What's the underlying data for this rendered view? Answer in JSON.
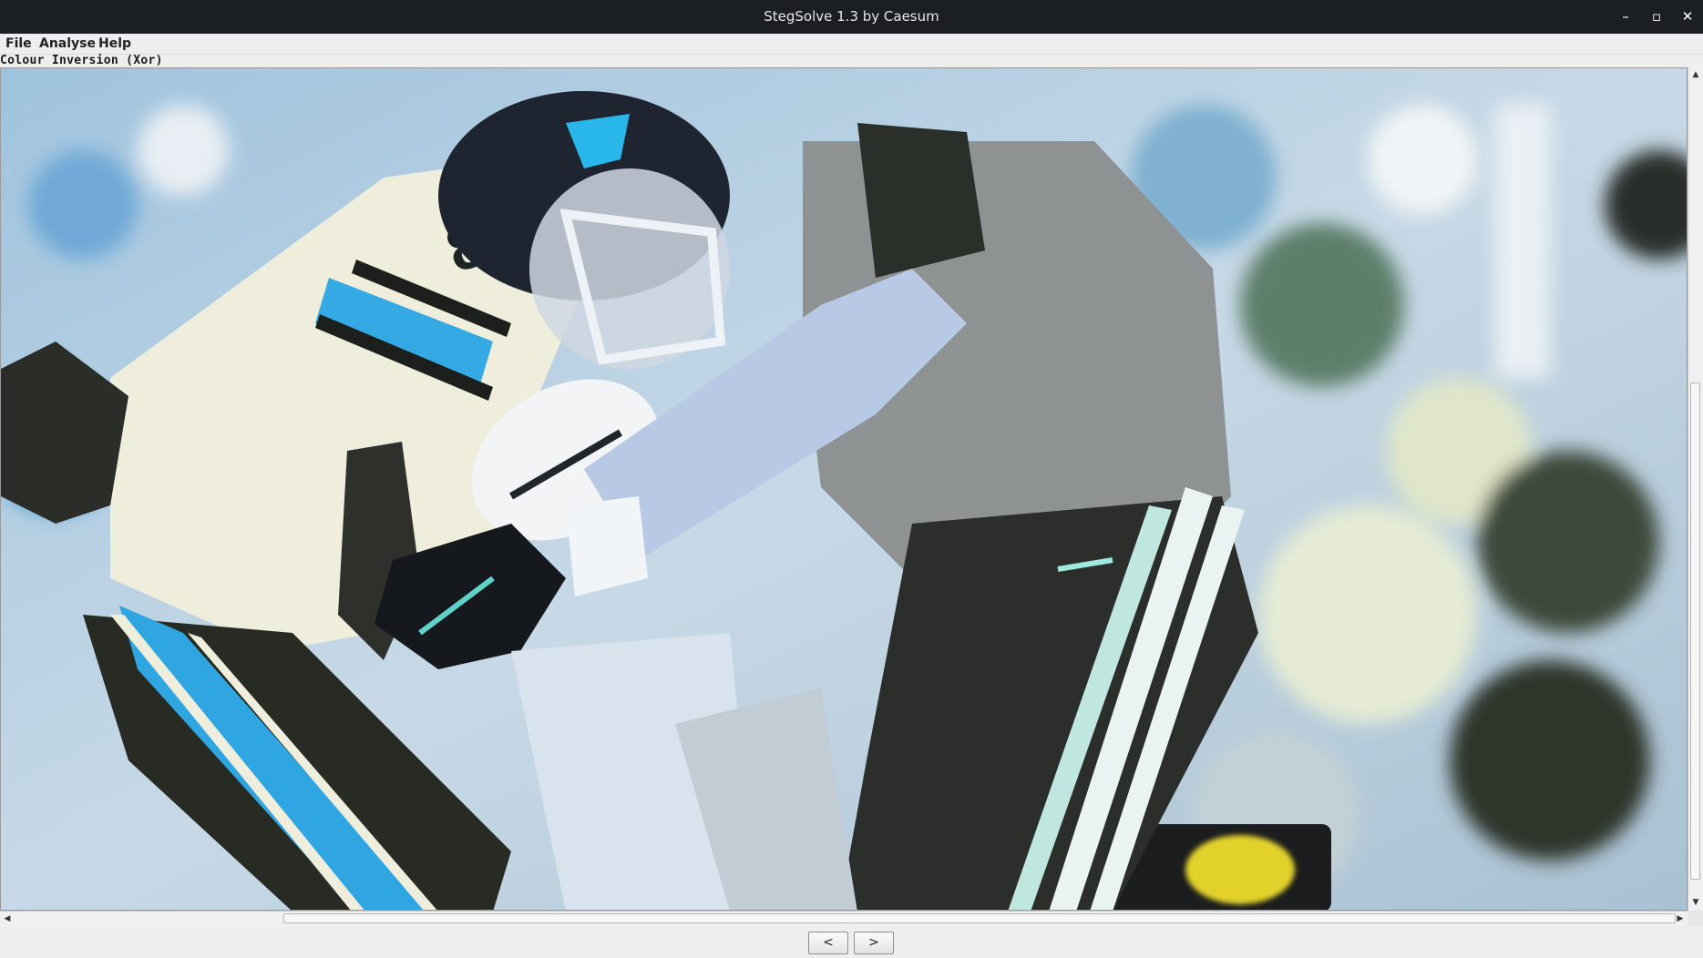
{
  "window": {
    "title": "StegSolve 1.3 by Caesum",
    "controls": {
      "minimize": "–",
      "maximize": "▫",
      "close": "✕"
    }
  },
  "menu": {
    "items": [
      "File",
      "Analyse",
      "Help"
    ]
  },
  "viewer": {
    "mode_label": "Colour Inversion (Xor)",
    "image_description": "inverted-color football photo"
  },
  "navigation": {
    "prev_label": "<",
    "next_label": ">"
  },
  "scrollbars": {
    "up_arrow": "▲",
    "down_arrow": "▼",
    "left_arrow": "◀",
    "right_arrow": "▶"
  },
  "colors": {
    "titlebar_bg": "#1b1e23",
    "window_bg": "#eeeeee"
  }
}
